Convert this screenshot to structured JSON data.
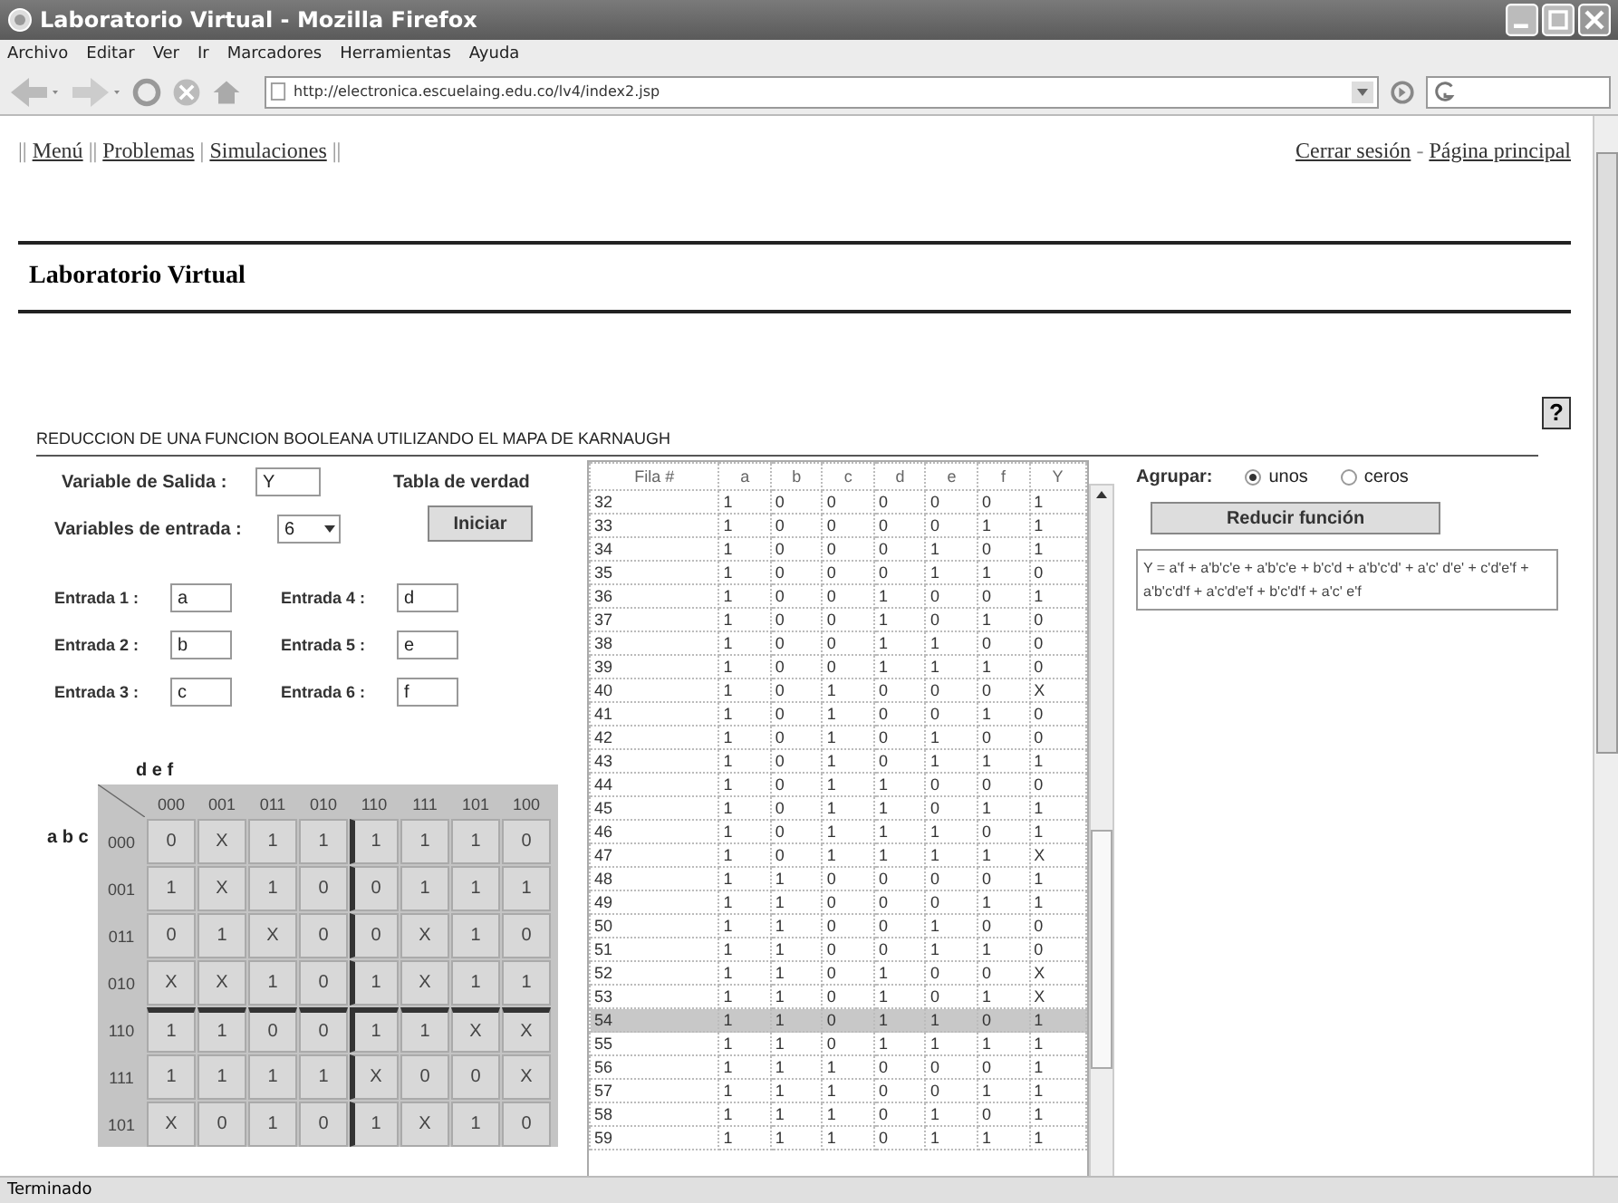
{
  "window": {
    "title": "Laboratorio Virtual - Mozilla Firefox"
  },
  "menu_bar": [
    "Archivo",
    "Editar",
    "Ver",
    "Ir",
    "Marcadores",
    "Herramientas",
    "Ayuda"
  ],
  "address_bar": {
    "url": "http://electronica.escuelaing.edu.co/lv4/index2.jsp"
  },
  "nav_left": [
    {
      "kind": "sep",
      "text": "||"
    },
    {
      "kind": "link",
      "text": "Menú"
    },
    {
      "kind": "sep",
      "text": "||"
    },
    {
      "kind": "link",
      "text": "Problemas"
    },
    {
      "kind": "sep",
      "text": "|"
    },
    {
      "kind": "link",
      "text": "Simulaciones"
    },
    {
      "kind": "sep",
      "text": "||"
    }
  ],
  "nav_right": [
    {
      "kind": "link",
      "text": "Cerrar sesión"
    },
    {
      "kind": "sep",
      "text": "-"
    },
    {
      "kind": "link",
      "text": "Página principal"
    }
  ],
  "page_title": "Laboratorio Virtual",
  "help_button": "?",
  "applet": {
    "heading": "REDUCCION DE UNA FUNCION BOOLEANA UTILIZANDO EL MAPA DE KARNAUGH",
    "output_label": "Variable de Salida :",
    "output_value": "Y",
    "truth_label": "Tabla de verdad",
    "inputs_label": "Variables de entrada :",
    "inputs_count": "6",
    "start_button": "Iniciar",
    "inputs": [
      {
        "label": "Entrada 1 :",
        "value": "a"
      },
      {
        "label": "Entrada 4 :",
        "value": "d"
      },
      {
        "label": "Entrada 2 :",
        "value": "b"
      },
      {
        "label": "Entrada 5 :",
        "value": "e"
      },
      {
        "label": "Entrada 3 :",
        "value": "c"
      },
      {
        "label": "Entrada 6 :",
        "value": "f"
      }
    ],
    "kmap": {
      "col_var": "d e f",
      "row_var": "a b c",
      "columns": [
        "000",
        "001",
        "011",
        "010",
        "110",
        "111",
        "101",
        "100"
      ],
      "rows": [
        {
          "label": "000",
          "cells": [
            "0",
            "X",
            "1",
            "1",
            "1",
            "1",
            "1",
            "0"
          ]
        },
        {
          "label": "001",
          "cells": [
            "1",
            "X",
            "1",
            "0",
            "0",
            "1",
            "1",
            "1"
          ]
        },
        {
          "label": "011",
          "cells": [
            "0",
            "1",
            "X",
            "0",
            "0",
            "X",
            "1",
            "0"
          ]
        },
        {
          "label": "010",
          "cells": [
            "X",
            "X",
            "1",
            "0",
            "1",
            "X",
            "1",
            "1"
          ]
        },
        {
          "label": "110",
          "cells": [
            "1",
            "1",
            "0",
            "0",
            "1",
            "1",
            "X",
            "X"
          ]
        },
        {
          "label": "111",
          "cells": [
            "1",
            "1",
            "1",
            "1",
            "X",
            "0",
            "0",
            "X"
          ]
        },
        {
          "label": "101",
          "cells": [
            "X",
            "0",
            "1",
            "0",
            "1",
            "X",
            "1",
            "0"
          ]
        }
      ]
    },
    "truth_table": {
      "columns": [
        "Fila #",
        "a",
        "b",
        "c",
        "d",
        "e",
        "f",
        "Y"
      ],
      "rows": [
        {
          "cells": [
            "32",
            "1",
            "0",
            "0",
            "0",
            "0",
            "0",
            "1"
          ],
          "selected": false
        },
        {
          "cells": [
            "33",
            "1",
            "0",
            "0",
            "0",
            "0",
            "1",
            "1"
          ],
          "selected": false
        },
        {
          "cells": [
            "34",
            "1",
            "0",
            "0",
            "0",
            "1",
            "0",
            "1"
          ],
          "selected": false
        },
        {
          "cells": [
            "35",
            "1",
            "0",
            "0",
            "0",
            "1",
            "1",
            "0"
          ],
          "selected": false
        },
        {
          "cells": [
            "36",
            "1",
            "0",
            "0",
            "1",
            "0",
            "0",
            "1"
          ],
          "selected": false
        },
        {
          "cells": [
            "37",
            "1",
            "0",
            "0",
            "1",
            "0",
            "1",
            "0"
          ],
          "selected": false
        },
        {
          "cells": [
            "38",
            "1",
            "0",
            "0",
            "1",
            "1",
            "0",
            "0"
          ],
          "selected": false
        },
        {
          "cells": [
            "39",
            "1",
            "0",
            "0",
            "1",
            "1",
            "1",
            "0"
          ],
          "selected": false
        },
        {
          "cells": [
            "40",
            "1",
            "0",
            "1",
            "0",
            "0",
            "0",
            "X"
          ],
          "selected": false
        },
        {
          "cells": [
            "41",
            "1",
            "0",
            "1",
            "0",
            "0",
            "1",
            "0"
          ],
          "selected": false
        },
        {
          "cells": [
            "42",
            "1",
            "0",
            "1",
            "0",
            "1",
            "0",
            "0"
          ],
          "selected": false
        },
        {
          "cells": [
            "43",
            "1",
            "0",
            "1",
            "0",
            "1",
            "1",
            "1"
          ],
          "selected": false
        },
        {
          "cells": [
            "44",
            "1",
            "0",
            "1",
            "1",
            "0",
            "0",
            "0"
          ],
          "selected": false
        },
        {
          "cells": [
            "45",
            "1",
            "0",
            "1",
            "1",
            "0",
            "1",
            "1"
          ],
          "selected": false
        },
        {
          "cells": [
            "46",
            "1",
            "0",
            "1",
            "1",
            "1",
            "0",
            "1"
          ],
          "selected": false
        },
        {
          "cells": [
            "47",
            "1",
            "0",
            "1",
            "1",
            "1",
            "1",
            "X"
          ],
          "selected": false
        },
        {
          "cells": [
            "48",
            "1",
            "1",
            "0",
            "0",
            "0",
            "0",
            "1"
          ],
          "selected": false
        },
        {
          "cells": [
            "49",
            "1",
            "1",
            "0",
            "0",
            "0",
            "1",
            "1"
          ],
          "selected": false
        },
        {
          "cells": [
            "50",
            "1",
            "1",
            "0",
            "0",
            "1",
            "0",
            "0"
          ],
          "selected": false
        },
        {
          "cells": [
            "51",
            "1",
            "1",
            "0",
            "0",
            "1",
            "1",
            "0"
          ],
          "selected": false
        },
        {
          "cells": [
            "52",
            "1",
            "1",
            "0",
            "1",
            "0",
            "0",
            "X"
          ],
          "selected": false
        },
        {
          "cells": [
            "53",
            "1",
            "1",
            "0",
            "1",
            "0",
            "1",
            "X"
          ],
          "selected": false
        },
        {
          "cells": [
            "54",
            "1",
            "1",
            "0",
            "1",
            "1",
            "0",
            "1"
          ],
          "selected": true
        },
        {
          "cells": [
            "55",
            "1",
            "1",
            "0",
            "1",
            "1",
            "1",
            "1"
          ],
          "selected": false
        },
        {
          "cells": [
            "56",
            "1",
            "1",
            "1",
            "0",
            "0",
            "0",
            "1"
          ],
          "selected": false
        },
        {
          "cells": [
            "57",
            "1",
            "1",
            "1",
            "0",
            "0",
            "1",
            "1"
          ],
          "selected": false
        },
        {
          "cells": [
            "58",
            "1",
            "1",
            "1",
            "0",
            "1",
            "0",
            "1"
          ],
          "selected": false
        },
        {
          "cells": [
            "59",
            "1",
            "1",
            "1",
            "0",
            "1",
            "1",
            "1"
          ],
          "selected": false
        }
      ]
    },
    "group": {
      "label": "Agrupar:",
      "options": [
        {
          "label": "unos",
          "selected": true
        },
        {
          "label": "ceros",
          "selected": false
        }
      ]
    },
    "reduce_button": "Reducir función",
    "result": "Y = a'f + a'b'c'e + a'b'c'e + b'c'd + a'b'c'd' + a'c' d'e' + c'd'e'f + a'b'c'd'f + a'c'd'e'f + b'c'd'f + a'c' e'f"
  },
  "status_bar": "Terminado"
}
